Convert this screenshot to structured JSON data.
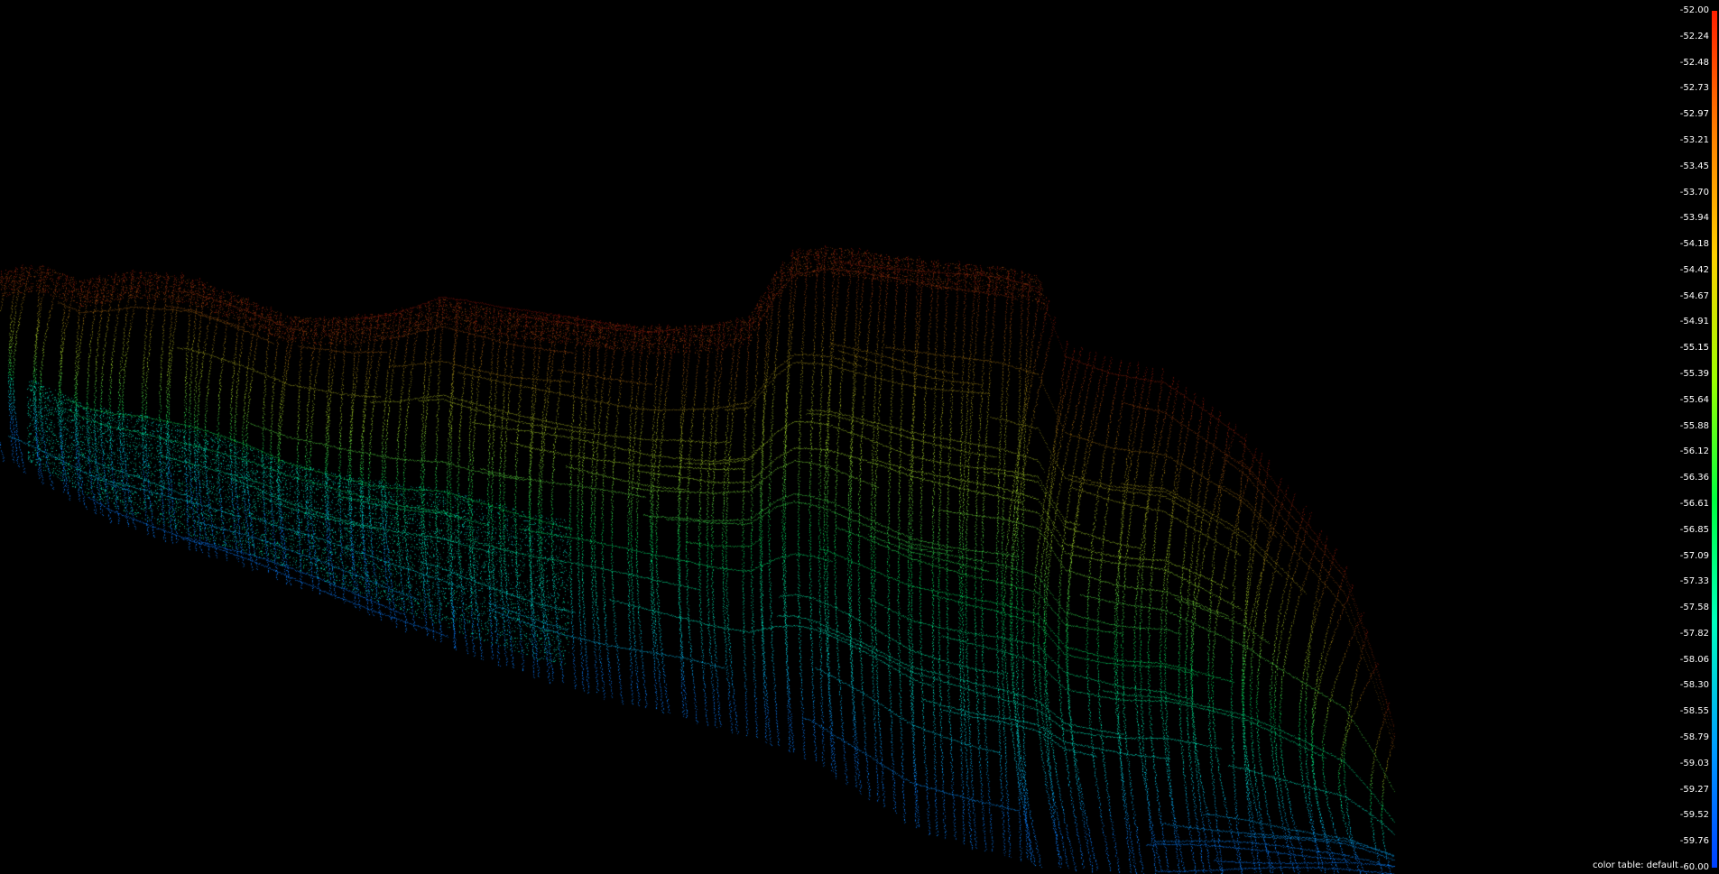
{
  "viewer": {
    "background_color": "#000000",
    "point_gradient": [
      "#0a7bff",
      "#00e8c8",
      "#00d85a",
      "#9ad02a",
      "#8a6a10",
      "#7a0f08"
    ]
  },
  "colorbar": {
    "tick_labels": [
      "-52.00",
      "-52.24",
      "-52.48",
      "-52.73",
      "-52.97",
      "-53.21",
      "-53.45",
      "-53.70",
      "-53.94",
      "-54.18",
      "-54.42",
      "-54.67",
      "-54.91",
      "-55.15",
      "-55.39",
      "-55.64",
      "-55.88",
      "-56.12",
      "-56.36",
      "-56.61",
      "-56.85",
      "-57.09",
      "-57.33",
      "-57.58",
      "-57.82",
      "-58.06",
      "-58.30",
      "-58.55",
      "-58.79",
      "-59.03",
      "-59.27",
      "-59.52",
      "-59.76",
      "-60.00"
    ],
    "gradient_colors": [
      "#ff2000",
      "#ff8000",
      "#ffd000",
      "#a0ff00",
      "#00ff40",
      "#00ffc0",
      "#00a0ff",
      "#0040ff"
    ],
    "max_value": -52.0,
    "min_value": -60.0
  },
  "color_table_text": "color table: default"
}
